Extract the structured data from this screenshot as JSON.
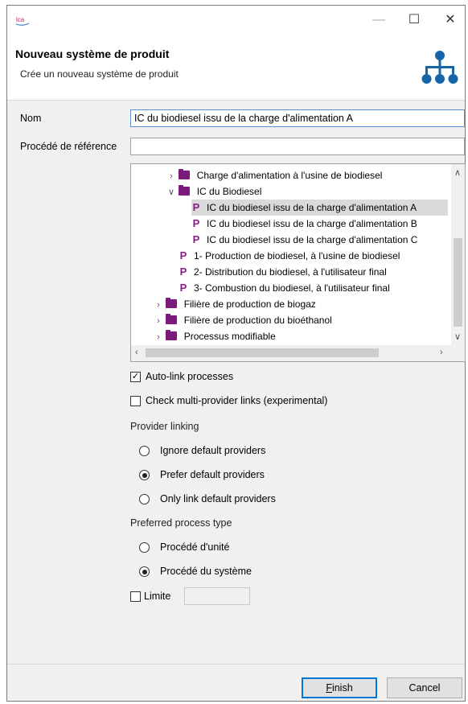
{
  "app": {
    "logo_text": "lca",
    "window_controls": {
      "minimize": "—",
      "maximize": "☐",
      "close": "✕"
    }
  },
  "header": {
    "title": "Nouveau système de produit",
    "description": "Crée un nouveau système de produit",
    "icon": "product-system-hierarchy-icon"
  },
  "form": {
    "name_label": "Nom",
    "name_value": "IC du biodiesel issu de la charge d'alimentation A",
    "ref_label": "Procédé de référence",
    "ref_value": ""
  },
  "tree": {
    "rows": [
      {
        "type": "folder",
        "expanded": false,
        "label": "Charge d'alimentation à l'usine de biodiesel"
      },
      {
        "type": "folder",
        "expanded": true,
        "label": "IC du Biodiesel"
      },
      {
        "type": "process",
        "label": "IC du biodiesel issu de la charge d'alimentation A",
        "selected": true
      },
      {
        "type": "process",
        "label": "IC du biodiesel issu de la charge d'alimentation B"
      },
      {
        "type": "process",
        "label": "IC du biodiesel issu de la charge d'alimentation C"
      },
      {
        "type": "process",
        "label": "1- Production de biodiesel, à l'usine de biodiesel"
      },
      {
        "type": "process",
        "label": "2- Distribution du biodiesel, à l'utilisateur final"
      },
      {
        "type": "process",
        "label": "3- Combustion du biodiesel, à l'utilisateur final"
      },
      {
        "type": "folder",
        "expanded": false,
        "label": "Filière de production de biogaz"
      },
      {
        "type": "folder",
        "expanded": false,
        "label": "Filière de production du bioéthanol"
      },
      {
        "type": "folder",
        "expanded": false,
        "label": "Processus modifiable"
      }
    ],
    "process_glyph": "P"
  },
  "options": {
    "auto_link": {
      "label": "Auto-link processes",
      "checked": true
    },
    "multi_provider": {
      "label": "Check multi-provider links (experimental)",
      "checked": false
    },
    "provider_linking": {
      "label": "Provider linking",
      "choices": [
        {
          "label": "Ignore default providers",
          "selected": false
        },
        {
          "label": "Prefer default providers",
          "selected": true
        },
        {
          "label": "Only link default providers",
          "selected": false
        }
      ]
    },
    "process_type": {
      "label": "Preferred process type",
      "choices": [
        {
          "label": "Procédé d'unité",
          "selected": false
        },
        {
          "label": "Procédé du système",
          "selected": true
        }
      ]
    },
    "limit": {
      "label": "Limite",
      "checked": false,
      "value": ""
    }
  },
  "buttons": {
    "finish_mnemonic": "F",
    "finish_rest": "inish",
    "cancel": "Cancel"
  },
  "colors": {
    "accent": "#0078d7",
    "folder": "#7b1a7b",
    "process_glyph": "#8a1c8a",
    "header_icon": "#1565a8"
  }
}
